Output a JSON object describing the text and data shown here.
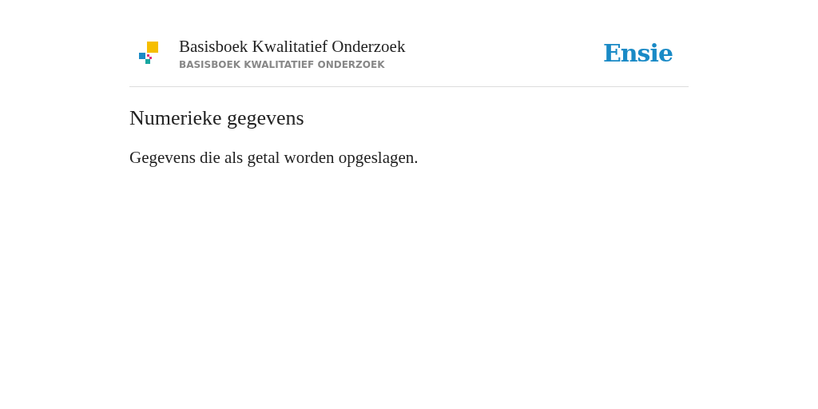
{
  "header": {
    "title": "Basisboek Kwalitatief Onderzoek",
    "subtitle": "BASISBOEK KWALITATIEF ONDERZOEK",
    "brand": "Ensie"
  },
  "entry": {
    "term": "Numerieke gegevens",
    "definition": "Gegevens die als getal worden opgeslagen."
  }
}
